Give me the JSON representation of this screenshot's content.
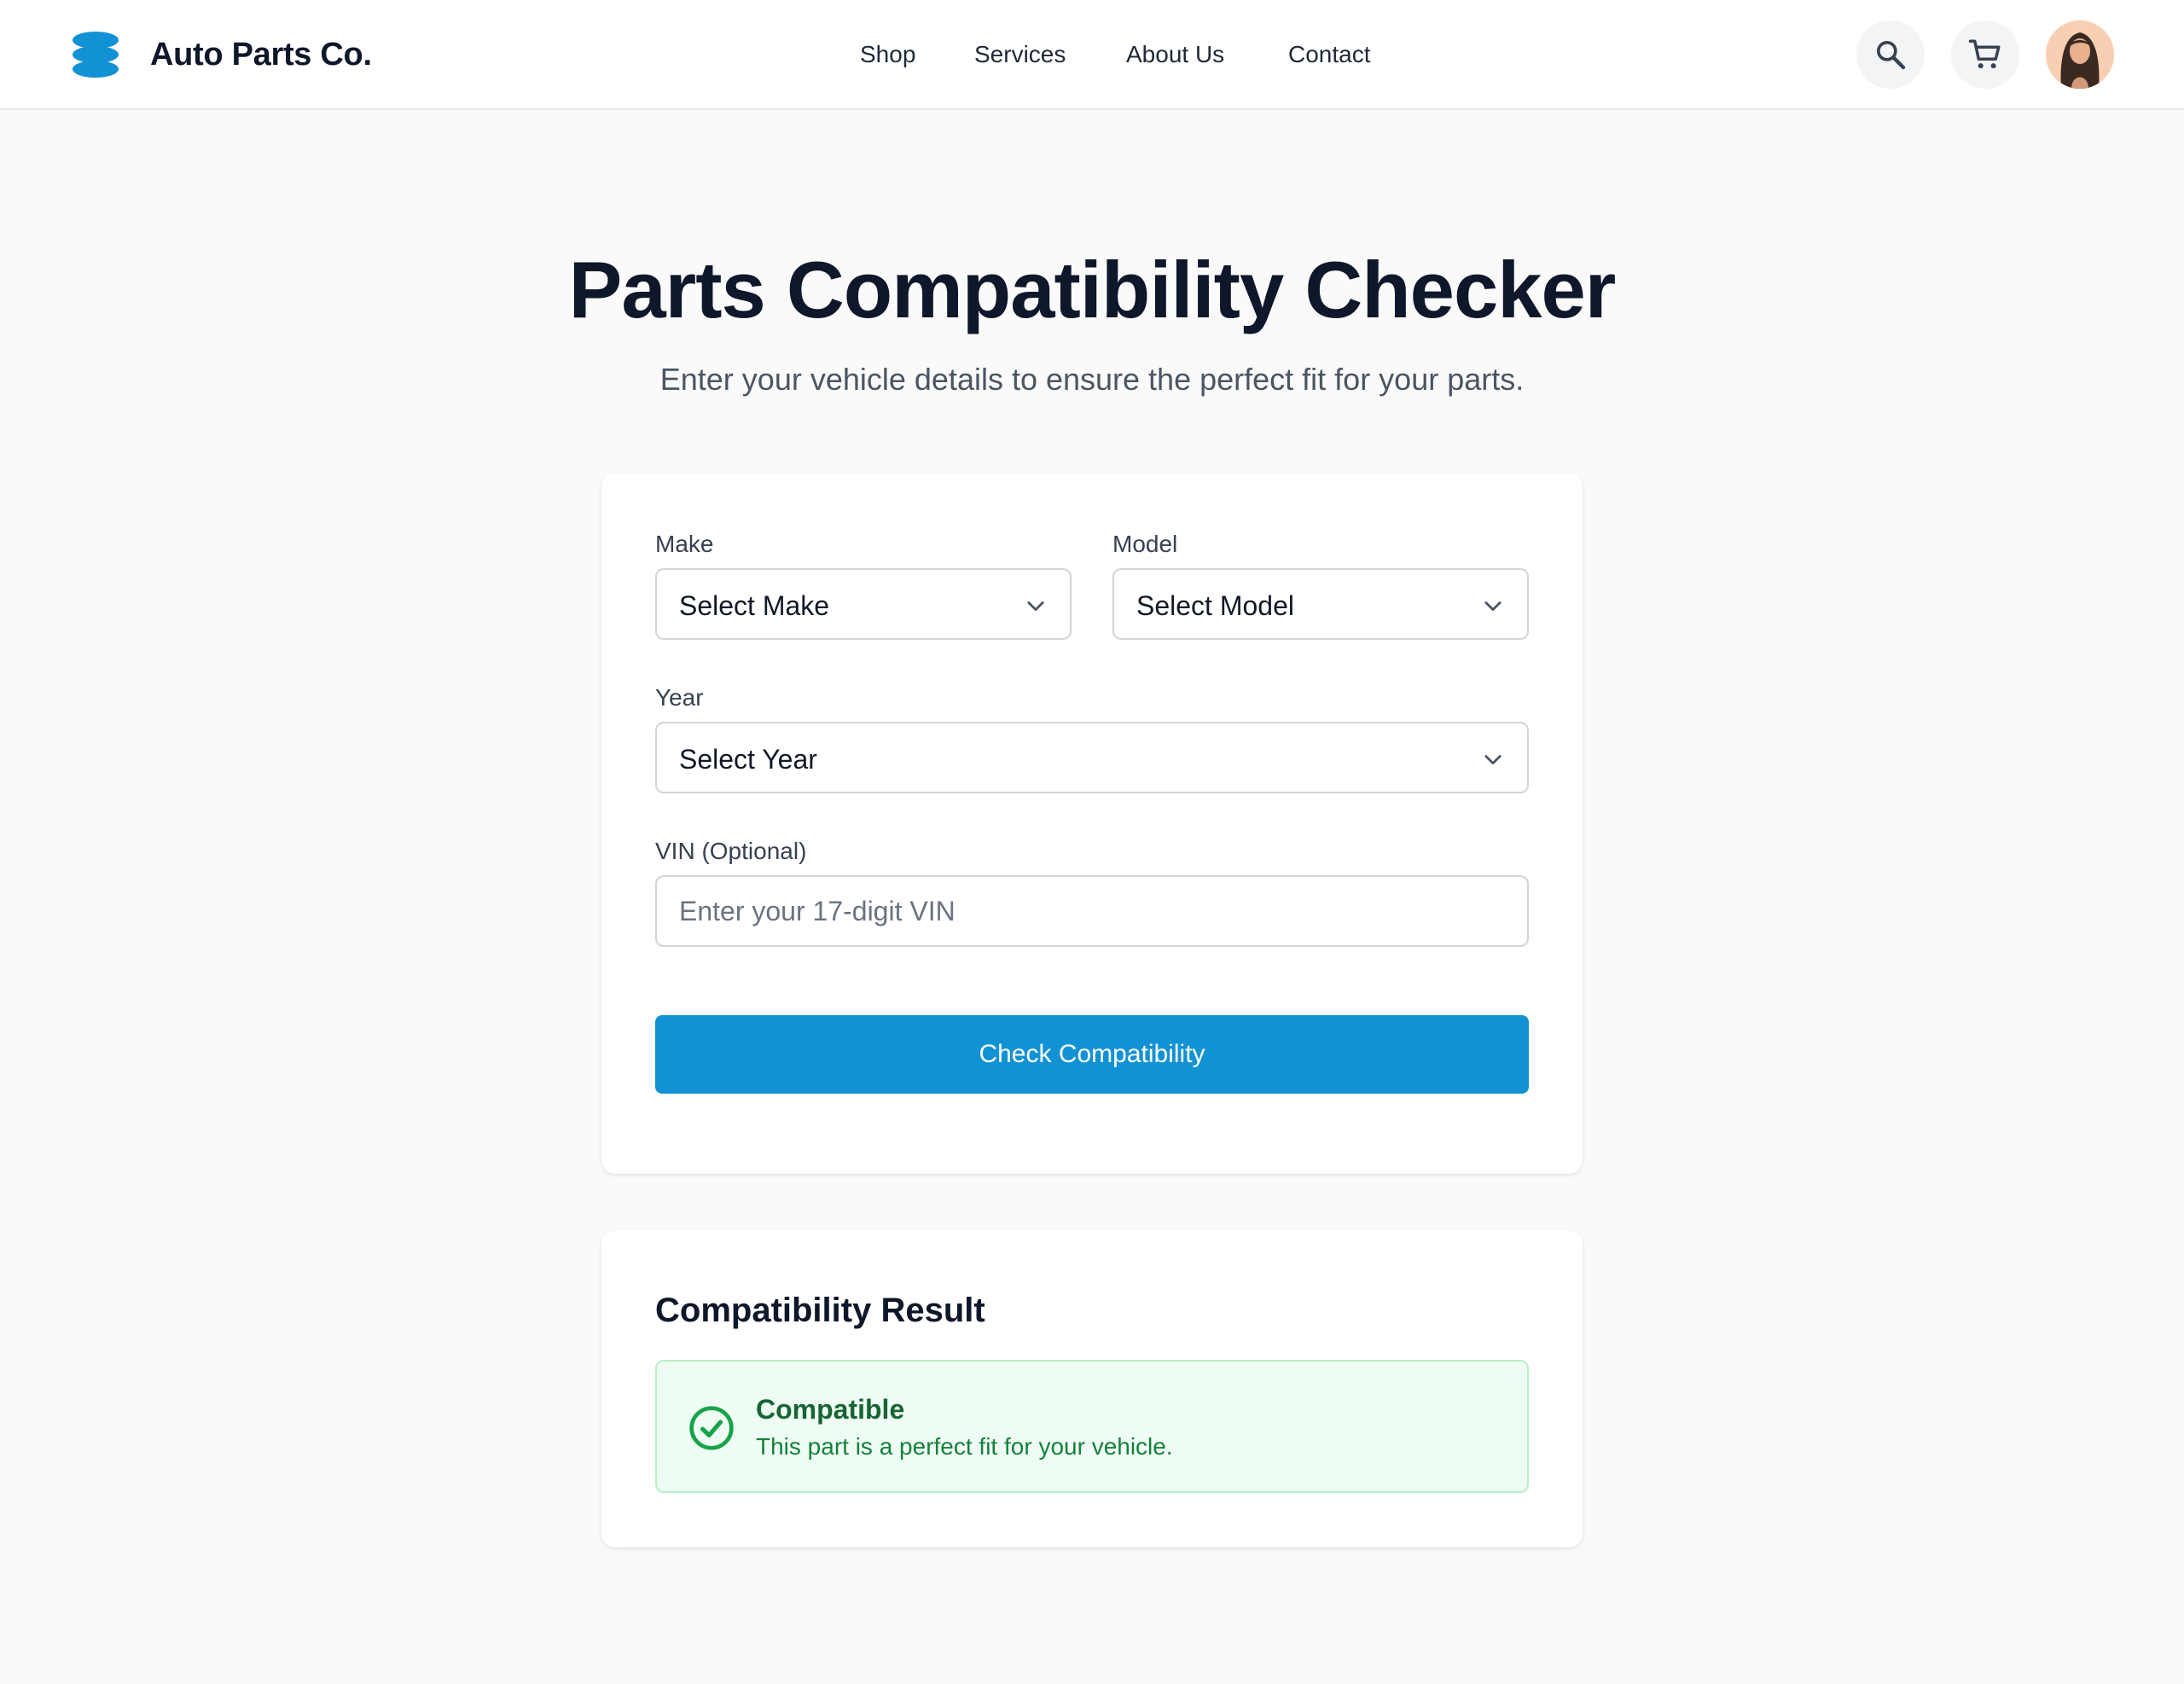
{
  "header": {
    "brand": "Auto Parts Co.",
    "logo_icon": "stacked-discs-logo",
    "nav": [
      {
        "label": "Shop"
      },
      {
        "label": "Services"
      },
      {
        "label": "About Us"
      },
      {
        "label": "Contact"
      }
    ],
    "search_icon": "search-icon",
    "cart_icon": "cart-icon",
    "avatar_icon": "user-avatar"
  },
  "hero": {
    "title": "Parts Compatibility Checker",
    "subtitle": "Enter your vehicle details to ensure the perfect fit for your parts."
  },
  "form": {
    "make_label": "Make",
    "make_value": "Select Make",
    "model_label": "Model",
    "model_value": "Select Model",
    "year_label": "Year",
    "year_value": "Select Year",
    "vin_label": "VIN (Optional)",
    "vin_placeholder": "Enter your 17-digit VIN",
    "submit_label": "Check Compatibility"
  },
  "result": {
    "heading": "Compatibility Result",
    "status": "Compatible",
    "message": "This part is a perfect fit for your vehicle."
  },
  "colors": {
    "accent": "#1292d4",
    "success_bg": "#effcf3",
    "success_text": "#166534",
    "success_icon": "#16a34a"
  }
}
